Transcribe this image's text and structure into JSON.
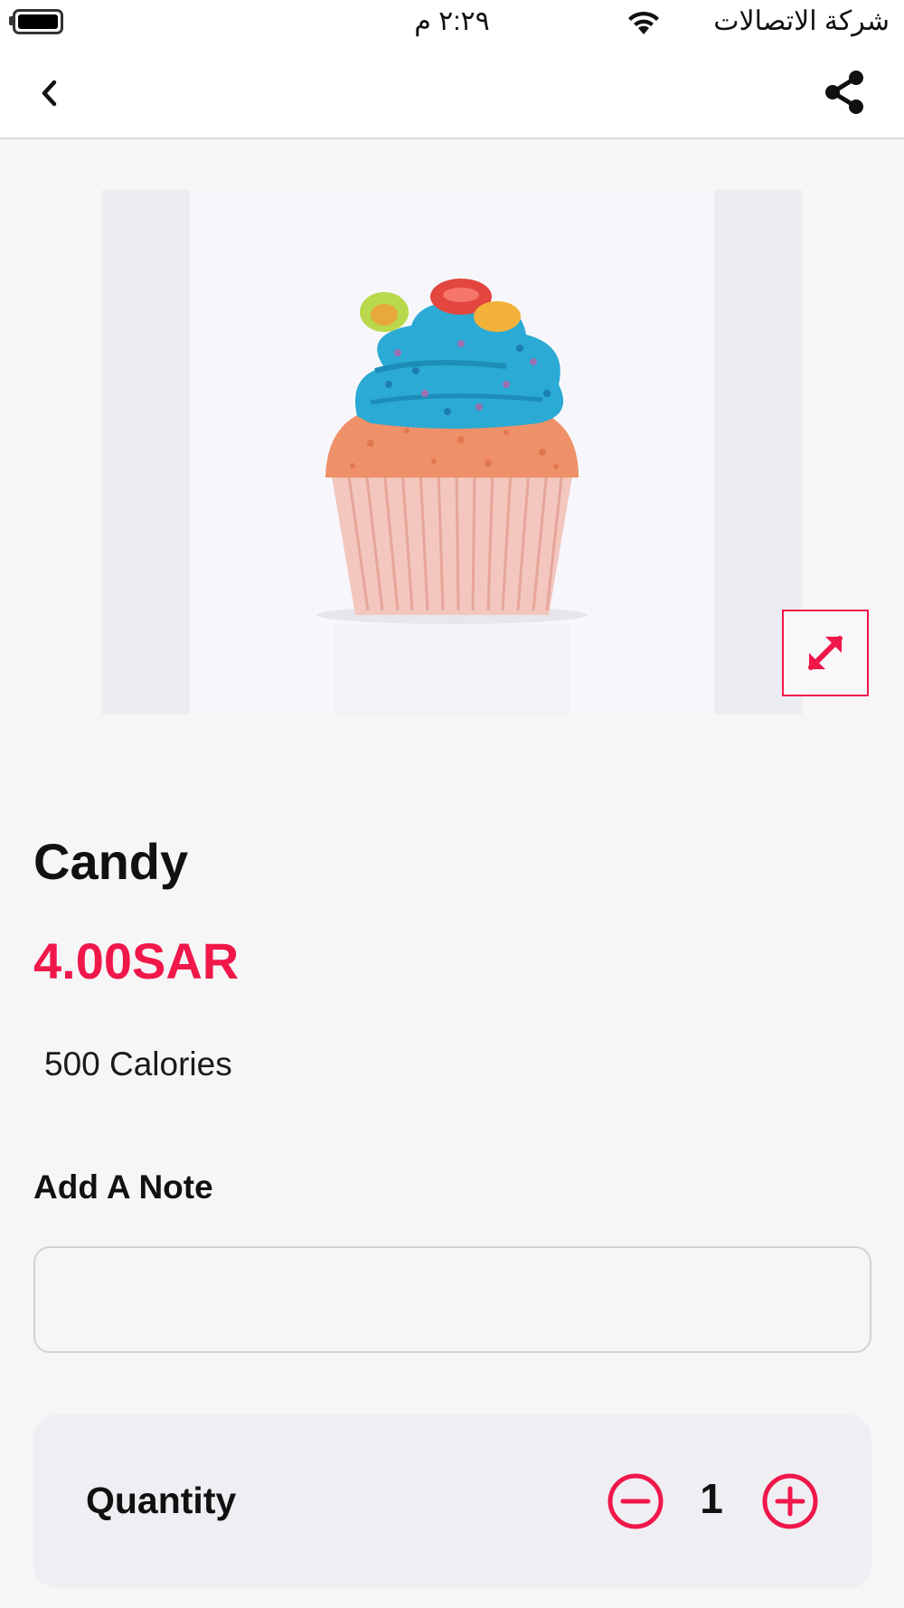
{
  "status_bar": {
    "time": "٢:٢٩ م",
    "carrier": "شركة الاتصالات",
    "icons": [
      "battery-icon",
      "wifi-icon"
    ]
  },
  "app_bar": {
    "icons": [
      "chevron-left-icon",
      "share-icon"
    ]
  },
  "product": {
    "image_subject": "cupcake",
    "name": "Candy",
    "price": "4.00SAR",
    "calories": "500 Calories",
    "expand_icon": "expand-arrows-icon"
  },
  "note": {
    "label": "Add A Note",
    "value": "",
    "placeholder": ""
  },
  "quantity": {
    "label": "Quantity",
    "value": "1",
    "icons": [
      "minus-circle-icon",
      "plus-circle-icon"
    ]
  },
  "colors": {
    "accent": "#f0174a",
    "background": "#f6f6f7",
    "card": "#efeff3"
  }
}
